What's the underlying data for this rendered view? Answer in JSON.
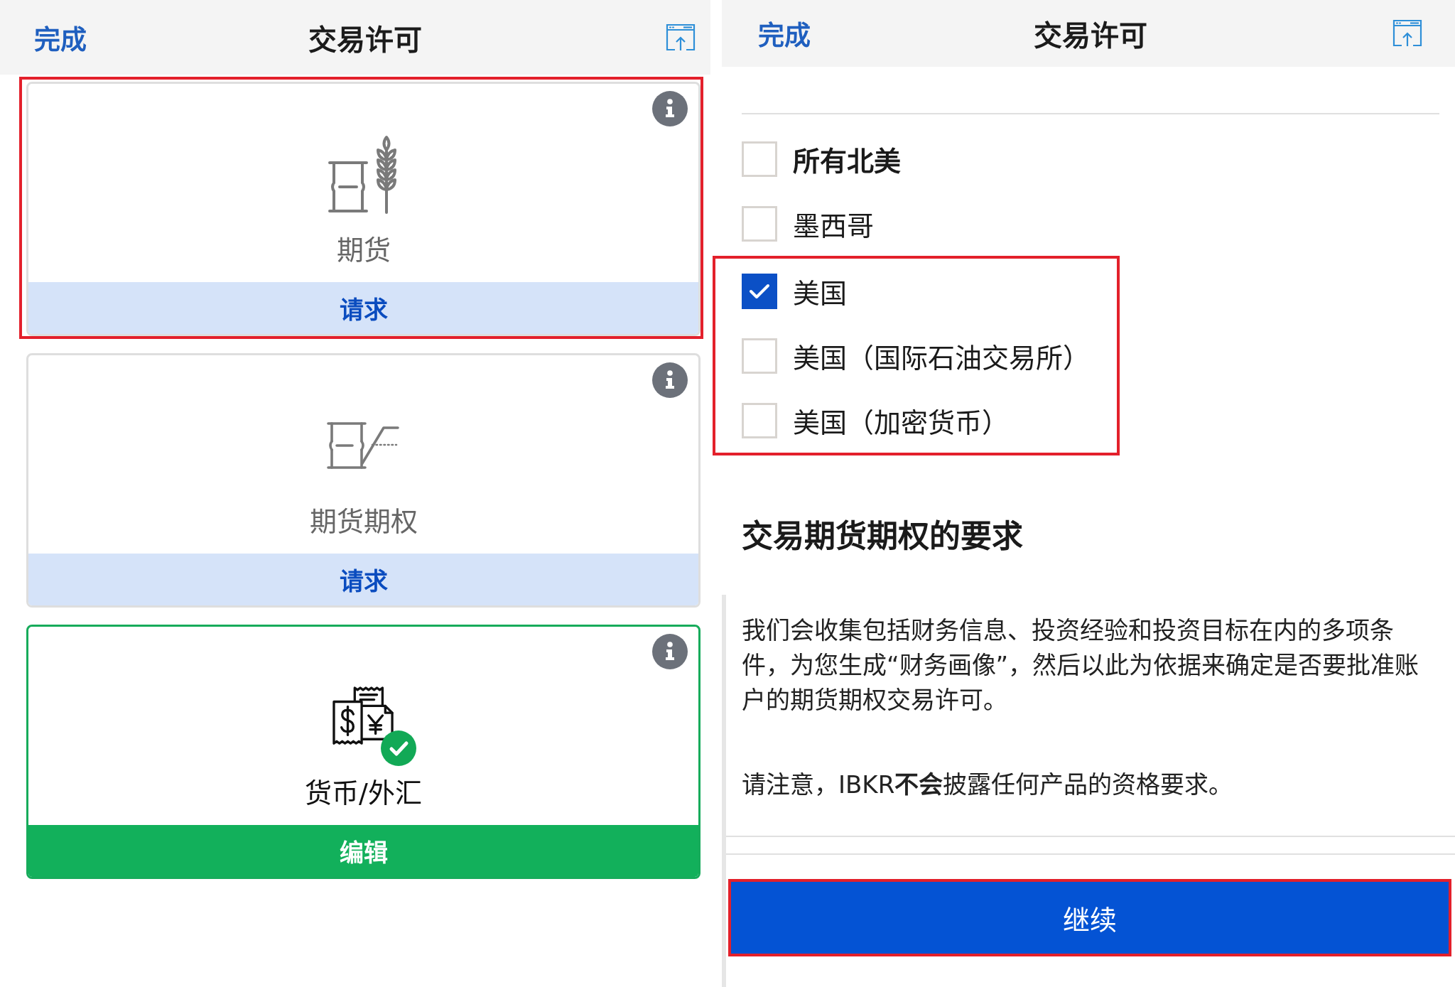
{
  "left_screen": {
    "header": {
      "done": "完成",
      "title": "交易许可"
    },
    "cards": [
      {
        "kind": "futures",
        "label": "期货",
        "action": "请求",
        "approved": false,
        "highlighted": true
      },
      {
        "kind": "futures_options",
        "label": "期货期权",
        "action": "请求",
        "approved": false,
        "highlighted": false
      },
      {
        "kind": "forex",
        "label": "货币/外汇",
        "action": "编辑",
        "approved": true,
        "highlighted": false
      }
    ]
  },
  "right_screen": {
    "header": {
      "done": "完成",
      "title": "交易许可"
    },
    "options": [
      {
        "kind": "group",
        "label": "所有北美",
        "checked": false,
        "highlighted": false
      },
      {
        "kind": "country",
        "label": "墨西哥",
        "checked": false,
        "highlighted": false
      },
      {
        "kind": "country",
        "label": "美国",
        "checked": true,
        "highlighted": true
      },
      {
        "kind": "country",
        "label": "美国（国际石油交易所）",
        "checked": false,
        "highlighted": true
      },
      {
        "kind": "country",
        "label": "美国（加密货币）",
        "checked": false,
        "highlighted": true
      }
    ],
    "requirements": {
      "heading": "交易期货期权的要求",
      "paragraphs": [
        "我们会收集包括财务信息、投资经验和投资目标在内的多项条件，为您生成“财务画像”，然后以此为依据来确定是否要批准账户的期货期权交易许可。",
        "请注意，IBKR**不会**披露任何产品的资格要求。"
      ]
    },
    "continue_button": {
      "label": "继续",
      "highlighted": true
    }
  }
}
